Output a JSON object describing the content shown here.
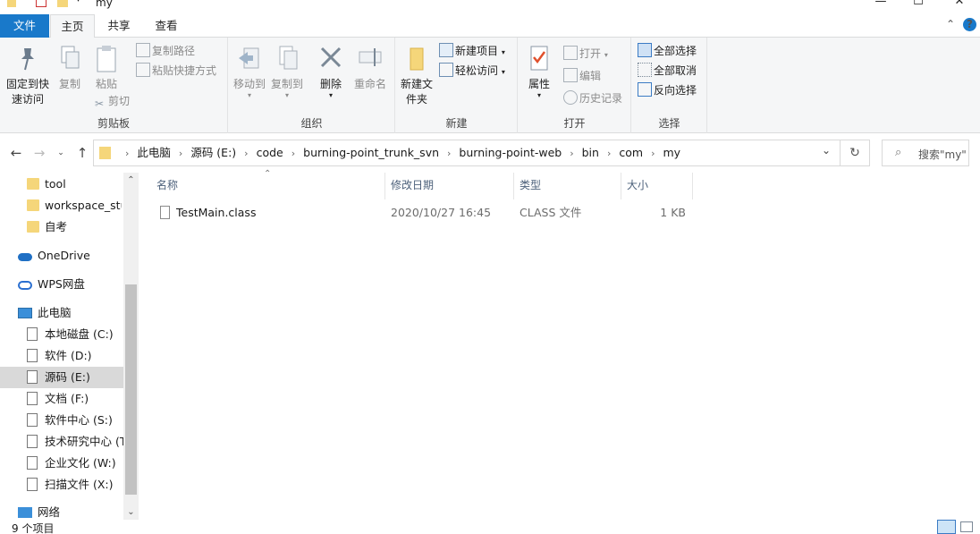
{
  "window": {
    "title": "my"
  },
  "ribbon_tabs": {
    "file": "文件",
    "home": "主页",
    "share": "共享",
    "view": "查看"
  },
  "ribbon": {
    "clipboard": {
      "label": "剪贴板",
      "pin": "固定到快速访问",
      "copy": "复制",
      "paste": "粘贴",
      "copy_path": "复制路径",
      "paste_shortcut": "粘贴快捷方式",
      "cut": "剪切"
    },
    "organize": {
      "label": "组织",
      "move_to": "移动到",
      "copy_to": "复制到",
      "delete": "删除",
      "rename": "重命名"
    },
    "new": {
      "label": "新建",
      "new_folder": "新建文件夹",
      "new_item": "新建项目",
      "easy_access": "轻松访问"
    },
    "open": {
      "label": "打开",
      "properties": "属性",
      "open": "打开",
      "edit": "编辑",
      "history": "历史记录"
    },
    "select": {
      "label": "选择",
      "select_all": "全部选择",
      "select_none": "全部取消",
      "invert": "反向选择"
    }
  },
  "address": {
    "crumbs": [
      "此电脑",
      "源码 (E:)",
      "code",
      "burning-point_trunk_svn",
      "burning-point-web",
      "bin",
      "com",
      "my"
    ],
    "search_placeholder": "搜索\"my\""
  },
  "nav_pane": {
    "items": [
      {
        "label": "tool"
      },
      {
        "label": "workspace_stu"
      },
      {
        "label": "自考"
      },
      {
        "label": "OneDrive"
      },
      {
        "label": "WPS网盘"
      },
      {
        "label": "此电脑"
      },
      {
        "label": "本地磁盘 (C:)"
      },
      {
        "label": "软件 (D:)"
      },
      {
        "label": "源码 (E:)"
      },
      {
        "label": "文档 (F:)"
      },
      {
        "label": "软件中心 (S:)"
      },
      {
        "label": "技术研究中心 (T"
      },
      {
        "label": "企业文化 (W:)"
      },
      {
        "label": "扫描文件 (X:)"
      },
      {
        "label": "网络"
      }
    ]
  },
  "file_list": {
    "columns": {
      "name": "名称",
      "modified": "修改日期",
      "type": "类型",
      "size": "大小"
    },
    "rows": [
      {
        "name": "TestMain.class",
        "modified": "2020/10/27 16:45",
        "type": "CLASS 文件",
        "size": "1 KB"
      }
    ]
  },
  "status": {
    "count": "9 个项目"
  },
  "colors": {
    "accent": "#1979ca",
    "folder": "#f5d67a",
    "selected_nav": "#d9d9d9"
  }
}
